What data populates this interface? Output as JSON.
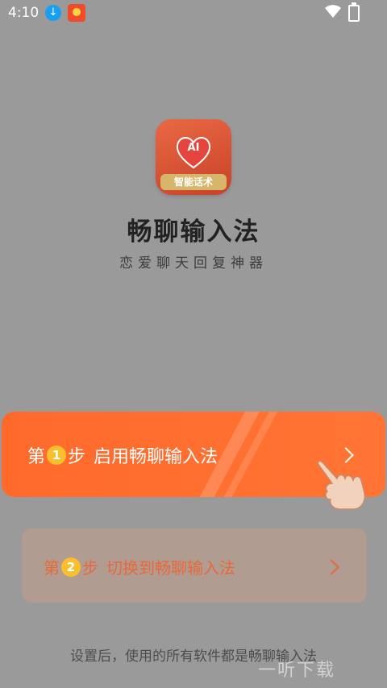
{
  "status_bar": {
    "time": "4:10",
    "icons": [
      "download-icon",
      "app-notification-icon",
      "wifi-icon",
      "battery-icon"
    ]
  },
  "app": {
    "title": "畅聊输入法",
    "subtitle": "恋爱聊天回复神器",
    "logo": {
      "badge_text": "AI",
      "label": "智能话术"
    }
  },
  "steps": [
    {
      "prefix": "第",
      "number": "1",
      "suffix": "步",
      "label": "启用畅聊输入法"
    },
    {
      "prefix": "第",
      "number": "2",
      "suffix": "步",
      "label": "切换到畅聊输入法"
    }
  ],
  "note": "设置后，使用的所有软件都是畅聊输入法",
  "watermark": "一听下载",
  "colors": {
    "primary": "#ff6a2b",
    "badge": "#f7c02c",
    "step2_text": "#e8683a",
    "overlay": "#9a9a9a"
  }
}
